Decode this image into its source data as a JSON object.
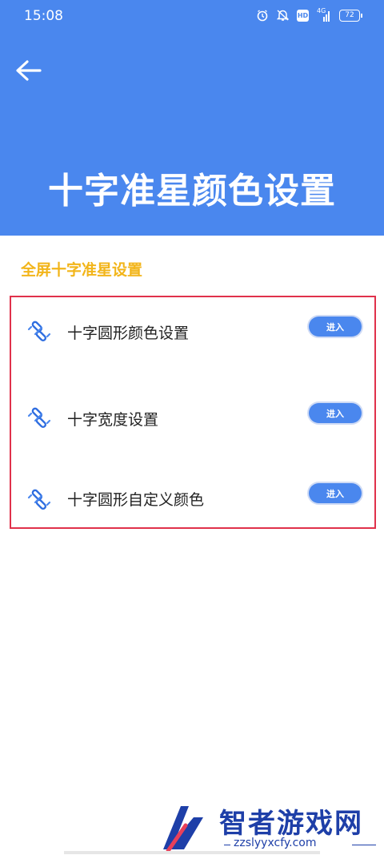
{
  "status_bar": {
    "time": "15:08",
    "icons": [
      "alarm-icon",
      "mute-icon",
      "hd-icon",
      "signal-4g-icon",
      "battery-icon"
    ],
    "hd_label": "HD",
    "network_label": "4G",
    "battery_level": "72"
  },
  "header": {
    "title": "十字准星颜色设置",
    "background_color": "#4a87ee"
  },
  "section": {
    "title": "全屏十字准星设置",
    "title_color": "#f2b51a"
  },
  "items": [
    {
      "label": "十字圆形颜色设置",
      "button": "进入",
      "icon": "crosshair-link-icon"
    },
    {
      "label": "十字宽度设置",
      "button": "进入",
      "icon": "crosshair-link-icon"
    },
    {
      "label": "十字圆形自定义颜色",
      "button": "进入",
      "icon": "crosshair-link-icon"
    }
  ],
  "watermark": {
    "title": "智者游戏网",
    "url": "zzslyyxcfy.com"
  },
  "colors": {
    "accent": "#4a87ee",
    "highlight_border": "#e0314b"
  }
}
